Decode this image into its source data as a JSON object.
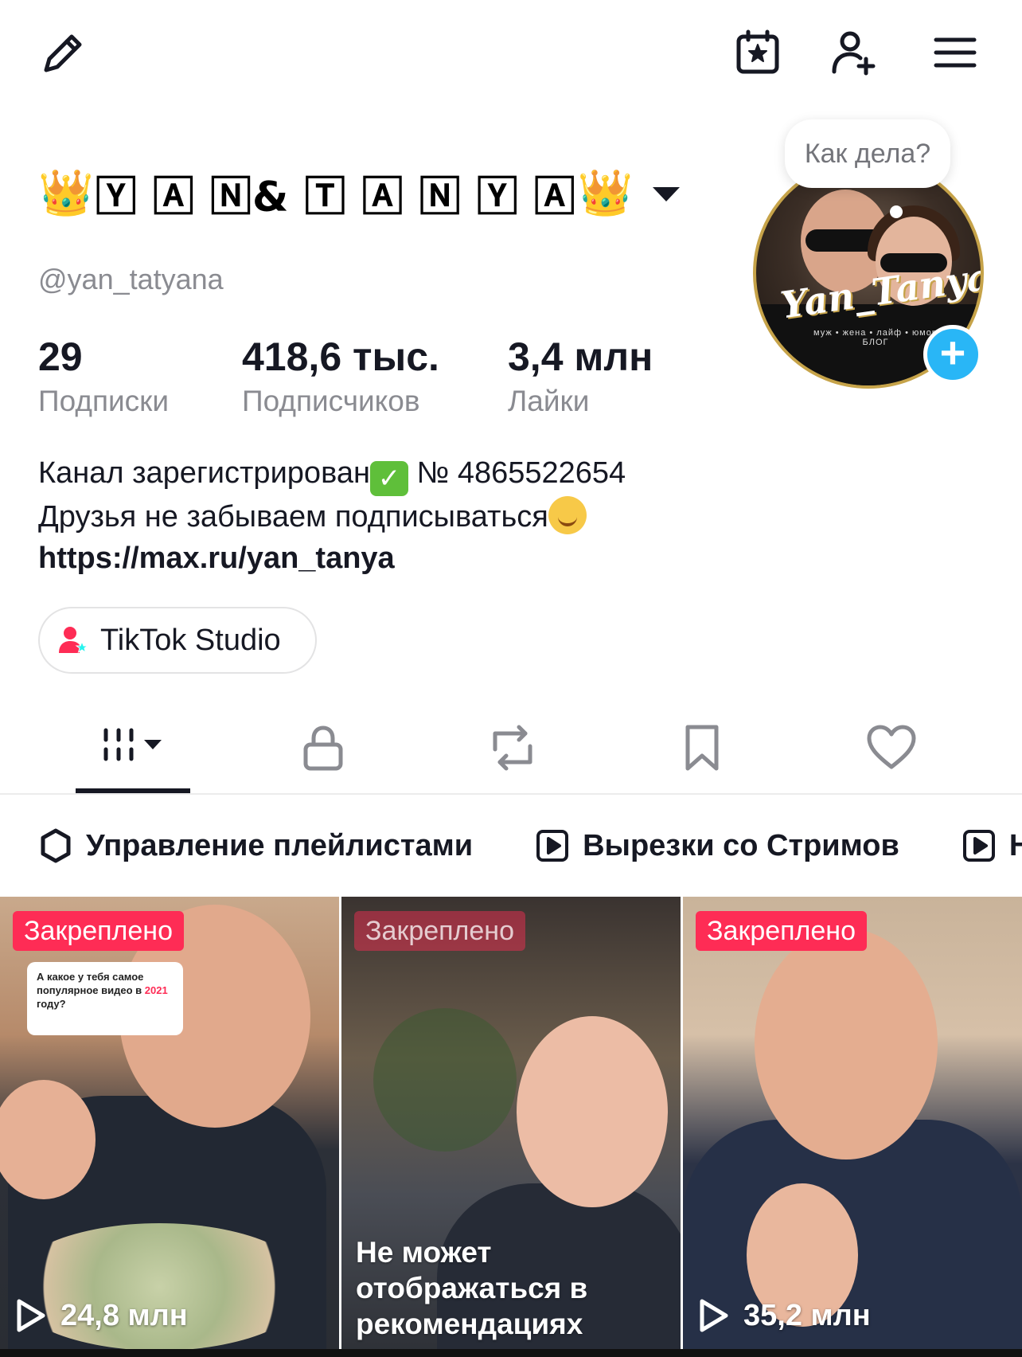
{
  "top_bar": {
    "icons": [
      "pencil-icon",
      "calendar-star-icon",
      "add-user-icon",
      "menu-icon"
    ]
  },
  "profile": {
    "display_name": "🅈 🄰 🄽& 🅃 🄰 🄽 🅈 🄰",
    "crown_left": "👑",
    "crown_right": "👑",
    "handle": "@yan_tatyana",
    "avatar_bubble": "Как дела?",
    "avatar_brand": "Yan_Tanya",
    "avatar_tagline": "муж • жена • лайф • юмор",
    "avatar_tagline2": "БЛОГ"
  },
  "stats": [
    {
      "value": "29",
      "label": "Подписки"
    },
    {
      "value": "418,6 тыс.",
      "label": "Подписчиков"
    },
    {
      "value": "3,4 млн",
      "label": "Лайки"
    }
  ],
  "bio": {
    "line1_a": "Канал зарегистрирован",
    "line1_b": " № 4865522654",
    "line2": "Друзья не забываем подписываться",
    "link": "https://max.ru/yan_tanya"
  },
  "studio_button": {
    "label": "TikTok Studio"
  },
  "tabs": [
    "videos-tab",
    "private-tab",
    "reposts-tab",
    "favorites-tab",
    "liked-tab"
  ],
  "playlists": [
    {
      "label": "Управление плейлистами",
      "icon": "gear-icon"
    },
    {
      "label": "Вырезки со Стримов",
      "icon": "play-square-icon"
    },
    {
      "label": "Н",
      "icon": "play-square-icon"
    }
  ],
  "videos": [
    {
      "badge": "Закреплено",
      "views": "24,8 млн",
      "card_text_a": "А какое у тебя самое популярное видео в",
      "card_year": "2021",
      "card_text_b": " году?"
    },
    {
      "badge": "Закреплено",
      "restricted_text": "Не может отображаться в рекомендациях"
    },
    {
      "badge": "Закреплено",
      "views": "35,2 млн"
    }
  ],
  "colors": {
    "accent": "#fe2c55",
    "primary_text": "#161823",
    "secondary_text": "#8a8b91",
    "plus_button": "#29b6f6"
  }
}
